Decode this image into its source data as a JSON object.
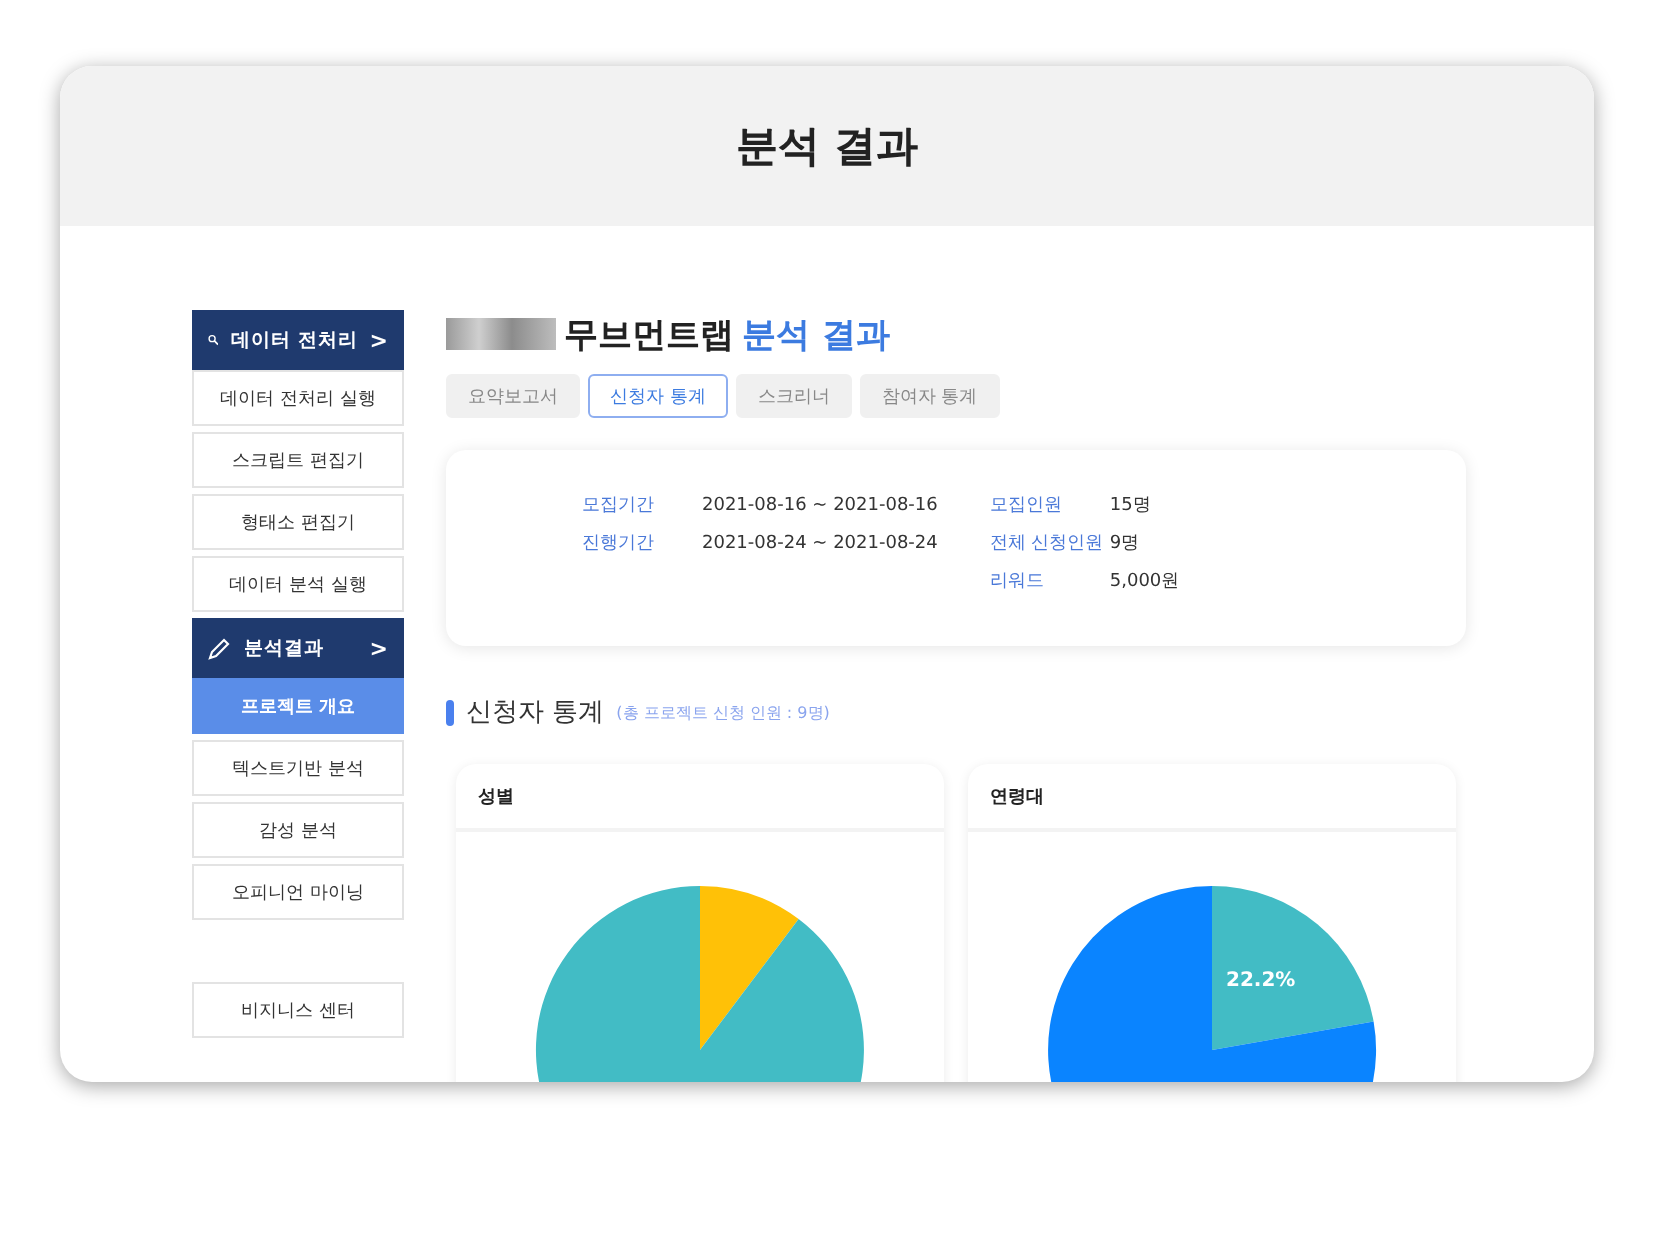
{
  "header": {
    "title": "분석 결과"
  },
  "sidebar": {
    "groups": [
      {
        "label": "데이터 전처리",
        "kind": "search",
        "chevron": ">",
        "items": [
          {
            "label": "데이터 전처리 실행",
            "selected": false
          },
          {
            "label": "스크립트 편집기",
            "selected": false
          },
          {
            "label": "형태소 편집기",
            "selected": false
          },
          {
            "label": "데이터 분석 실행",
            "selected": false
          }
        ]
      },
      {
        "label": "분석결과",
        "kind": "edit",
        "chevron": ">",
        "items": [
          {
            "label": "프로젝트 개요",
            "selected": true
          },
          {
            "label": "텍스트기반 분석",
            "selected": false
          },
          {
            "label": "감성 분석",
            "selected": false
          },
          {
            "label": "오피니언 마이닝",
            "selected": false
          }
        ]
      }
    ],
    "footer_button": "비지니스 센터"
  },
  "page_title": {
    "name": "무브먼트랩",
    "suffix": "분석 결과"
  },
  "tabs": [
    {
      "label": "요약보고서",
      "selected": false
    },
    {
      "label": "신청자 통계",
      "selected": true
    },
    {
      "label": "스크리너",
      "selected": false
    },
    {
      "label": "참여자 통계",
      "selected": false
    }
  ],
  "info": {
    "left": [
      {
        "label": "모집기간",
        "value": "2021-08-16 ~ 2021-08-16"
      },
      {
        "label": "진행기간",
        "value": "2021-08-24 ~ 2021-08-24"
      }
    ],
    "right": [
      {
        "label": "모집인원",
        "value": "15명"
      },
      {
        "label": "전체 신청인원",
        "value": "9명"
      },
      {
        "label": "리워드",
        "value": "5,000원"
      }
    ]
  },
  "section": {
    "title": "신청자 통계",
    "note": "(총 프로젝트 신청 인원 : 9명)"
  },
  "charts": [
    {
      "title": "성별",
      "kind": "gender"
    },
    {
      "title": "연령대",
      "kind": "age",
      "label": "22.2%"
    }
  ]
}
